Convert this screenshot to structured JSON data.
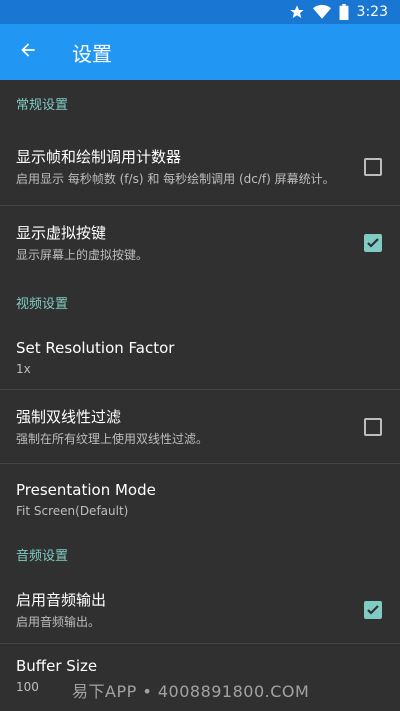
{
  "status": {
    "time": "3:23"
  },
  "appbar": {
    "title": "设置"
  },
  "sections": {
    "general": {
      "header": "常规设置"
    },
    "video": {
      "header": "视频设置"
    },
    "audio": {
      "header": "音频设置"
    }
  },
  "prefs": {
    "fps_counter": {
      "title": "显示帧和绘制调用计数器",
      "summary": "启用显示 每秒帧数 (f/s) 和 每秒绘制调用 (dc/f) 屏幕统计。",
      "checked": false
    },
    "virtual_keys": {
      "title": "显示虚拟按键",
      "summary": "显示屏幕上的虚拟按键。",
      "checked": true
    },
    "resolution": {
      "title": "Set Resolution Factor",
      "summary": "1x"
    },
    "bilinear": {
      "title": "强制双线性过滤",
      "summary": "强制在所有纹理上使用双线性过滤。",
      "checked": false
    },
    "presentation": {
      "title": "Presentation Mode",
      "summary": "Fit Screen(Default)"
    },
    "audio_output": {
      "title": "启用音频输出",
      "summary": "启用音频输出。",
      "checked": true
    },
    "buffer": {
      "title": "Buffer Size",
      "summary": "100"
    }
  },
  "watermark": "易下APP • 4008891800.COM",
  "colors": {
    "appbar": "#2196f3",
    "statusbar": "#1976d2",
    "accent": "#80cbc4",
    "background": "#303030"
  }
}
